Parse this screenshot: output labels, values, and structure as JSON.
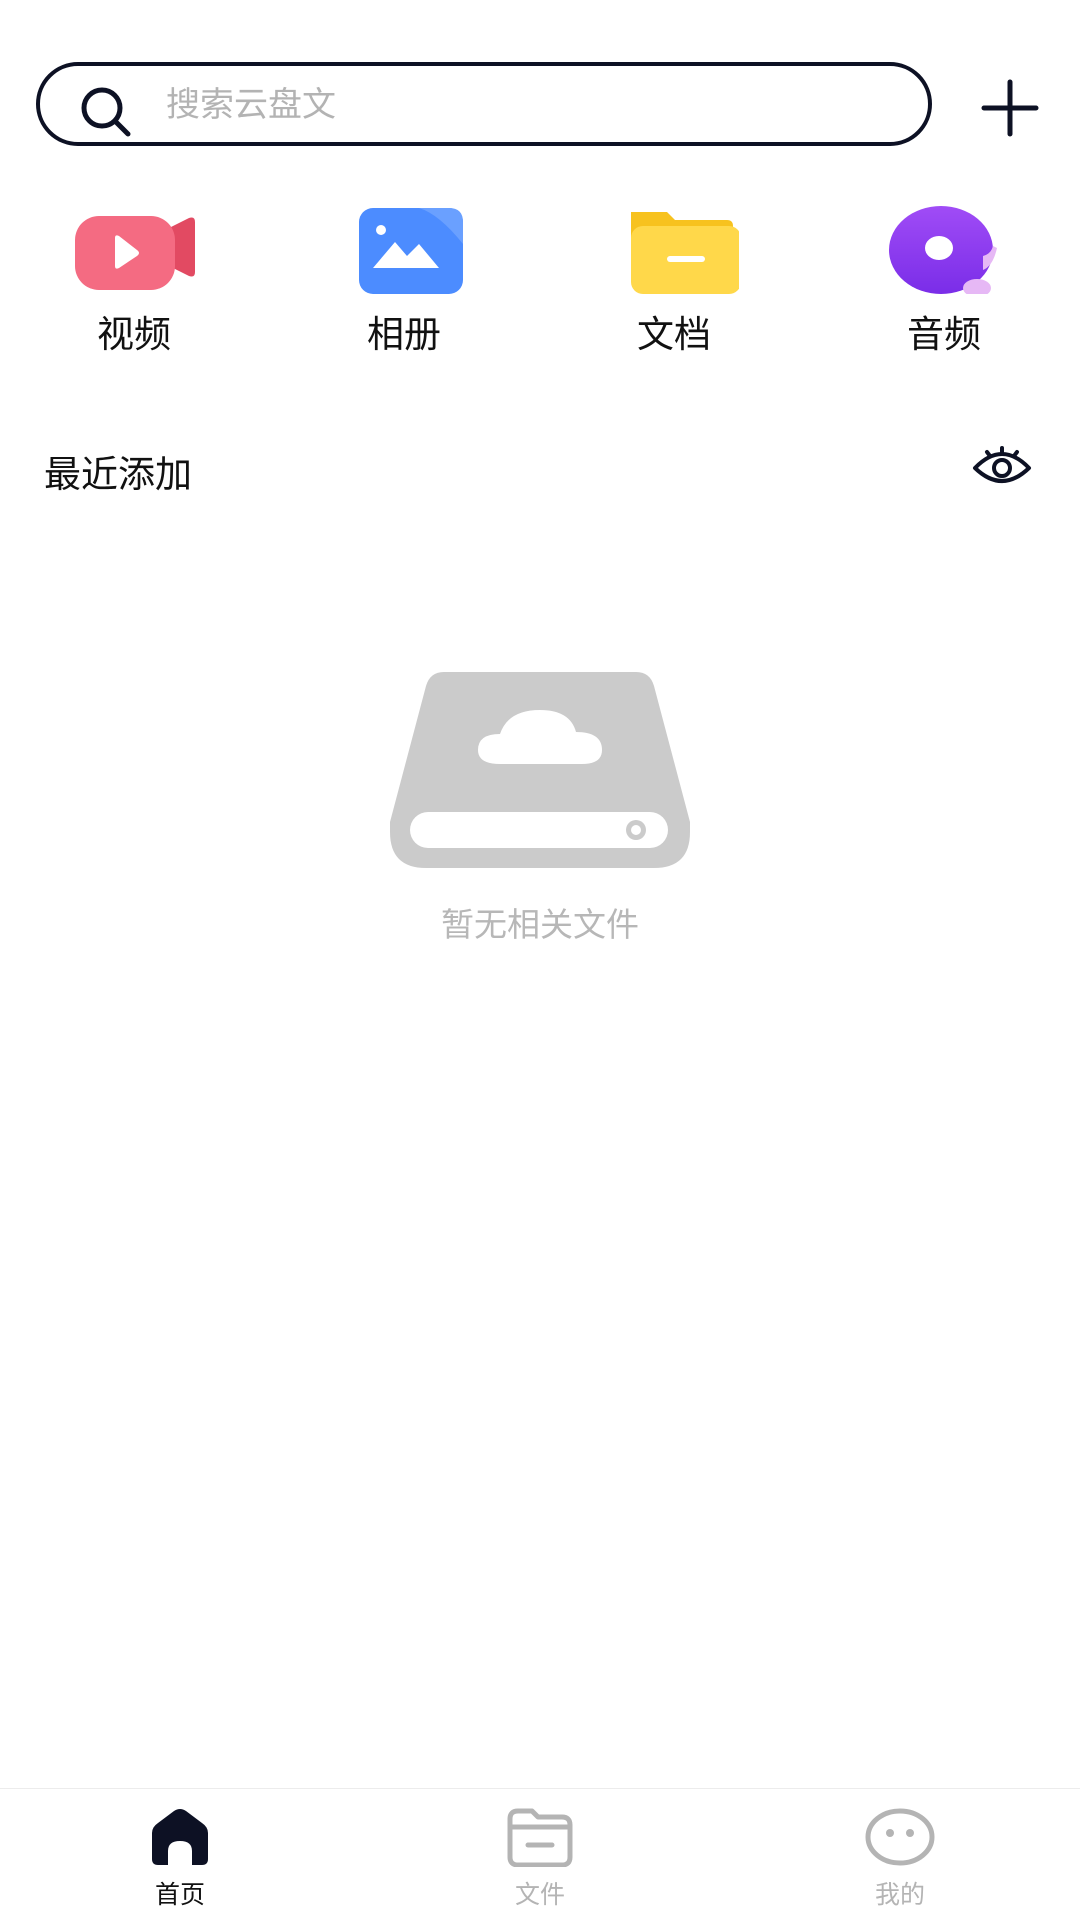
{
  "search": {
    "placeholder": "搜索云盘文"
  },
  "header": {
    "add_icon": "plus-icon"
  },
  "categories": [
    {
      "label": "视频",
      "icon": "video-icon",
      "color": "#f2526c"
    },
    {
      "label": "相册",
      "icon": "album-icon",
      "color": "#4c8cff"
    },
    {
      "label": "文档",
      "icon": "document-folder-icon",
      "color": "#ffd43b"
    },
    {
      "label": "音频",
      "icon": "audio-icon",
      "color": "#8b3cf0"
    }
  ],
  "recent": {
    "title": "最近添加",
    "visibility_icon": "eye-icon"
  },
  "empty": {
    "text": "暂无相关文件",
    "icon": "cloud-drive-icon"
  },
  "tabbar": {
    "items": [
      {
        "label": "首页",
        "icon": "home-icon",
        "active": true
      },
      {
        "label": "文件",
        "icon": "folder-icon",
        "active": false
      },
      {
        "label": "我的",
        "icon": "profile-icon",
        "active": false
      }
    ]
  }
}
